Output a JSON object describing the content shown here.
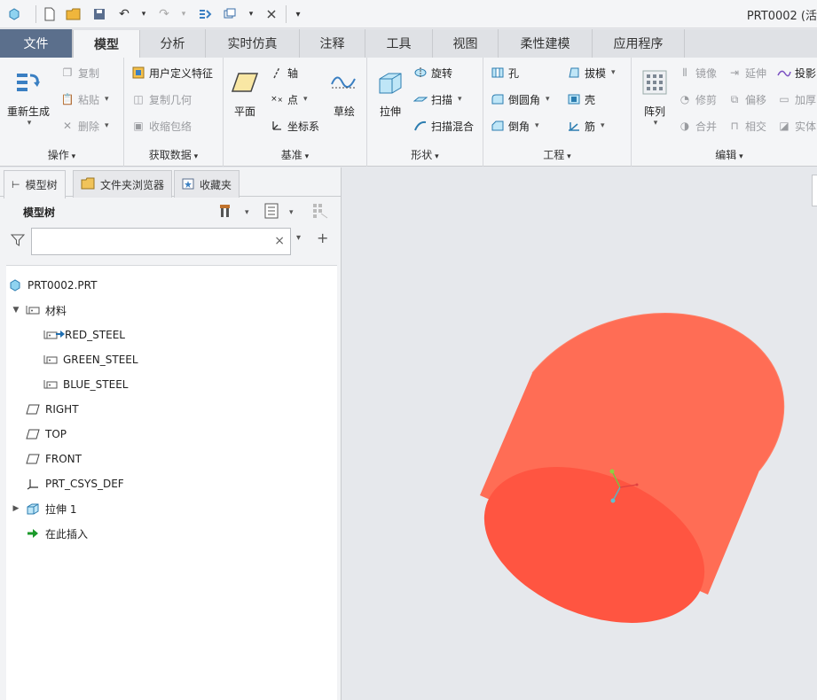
{
  "window": {
    "title": "PRT0002 (活"
  },
  "tabs": [
    "文件",
    "模型",
    "分析",
    "实时仿真",
    "注释",
    "工具",
    "视图",
    "柔性建模",
    "应用程序"
  ],
  "ribbon": {
    "operations": {
      "label": "操作",
      "regen": "重新生成",
      "copy": "复制",
      "paste": "粘贴",
      "delete": "删除"
    },
    "getdata": {
      "label": "获取数据",
      "udf": "用户定义特征",
      "copygeom": "复制几何",
      "shrinkwrap": "收缩包络"
    },
    "datum": {
      "label": "基准",
      "plane": "平面",
      "axis": "轴",
      "point": "点",
      "csys": "坐标系",
      "sketch": "草绘"
    },
    "shapes": {
      "label": "形状",
      "extrude": "拉伸",
      "revolve": "旋转",
      "sweep": "扫描",
      "sweepblend": "扫描混合"
    },
    "engineering": {
      "label": "工程",
      "hole": "孔",
      "round": "倒圆角",
      "chamfer": "倒角",
      "draft": "拔模",
      "shell": "壳",
      "rib": "筋"
    },
    "editing": {
      "label": "编辑",
      "pattern": "阵列",
      "mirror": "镜像",
      "trim": "修剪",
      "merge": "合并",
      "extend": "延伸",
      "offset": "偏移",
      "intersect": "相交",
      "project": "投影",
      "thicken": "加厚",
      "solidify": "实体"
    }
  },
  "panel": {
    "tabs": [
      "模型树",
      "文件夹浏览器",
      "收藏夹"
    ],
    "heading": "模型树",
    "search_placeholder": "",
    "tree": [
      "PRT0002.PRT",
      "材料",
      "RED_STEEL",
      "GREEN_STEEL",
      "BLUE_STEEL",
      "RIGHT",
      "TOP",
      "FRONT",
      "PRT_CSYS_DEF",
      "拉伸 1",
      "在此插入"
    ]
  },
  "colors": {
    "file_tab": "#5b6f8c",
    "part_face": "#ff5541",
    "part_side": "#ff6e55",
    "insert_arrow": "#1a9a2a"
  }
}
